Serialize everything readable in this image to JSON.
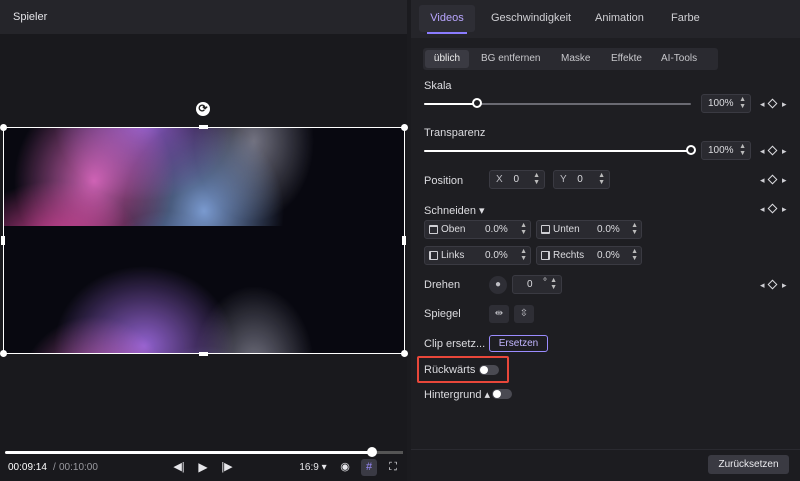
{
  "player": {
    "title": "Spieler",
    "rotate_glyph": "⟳",
    "time_current": "00:09:14",
    "time_separator": "/",
    "time_total": "00:10:00",
    "progress_fraction": 0.923,
    "controls": {
      "prev_frame_glyph": "◀|",
      "play_glyph": "▶",
      "next_frame_glyph": "|▶",
      "aspect_ratio": "16:9 ▾",
      "snapshot_glyph": "◉",
      "grid_glyph": "#",
      "fullscreen_glyph": "⛶"
    }
  },
  "editor": {
    "tabs": {
      "videos": "Videos",
      "speed": "Geschwindigkeit",
      "animation": "Animation",
      "color": "Farbe"
    },
    "subtabs": {
      "ueblich": "üblich",
      "bg_remove": "BG entfernen",
      "mask": "Maske",
      "effects": "Effekte",
      "ai_tools": "AI-Tools"
    },
    "scale": {
      "label": "Skala",
      "value": "100%",
      "fraction": 0.2
    },
    "opacity": {
      "label": "Transparenz",
      "value": "100%",
      "fraction": 1.0
    },
    "position": {
      "label": "Position",
      "x_label": "X",
      "x_value": "0",
      "y_label": "Y",
      "y_value": "0"
    },
    "crop": {
      "label": "Schneiden ▾",
      "top_label": "Oben",
      "top_value": "0.0%",
      "bottom_label": "Unten",
      "bottom_value": "0.0%",
      "left_label": "Links",
      "left_value": "0.0%",
      "right_label": "Rechts",
      "right_value": "0.0%"
    },
    "rotate": {
      "label": "Drehen",
      "value": "0",
      "unit": "°"
    },
    "mirror": {
      "label": "Spiegel"
    },
    "clip_replace": {
      "label": "Clip ersetz...",
      "button": "Ersetzen"
    },
    "reverse": {
      "label": "Rückwärts",
      "enabled": false
    },
    "background": {
      "label": "Hintergrund ▴",
      "enabled": false
    },
    "reset_button": "Zurücksetzen"
  },
  "colors": {
    "accent": "#8b7cff",
    "highlight": "#e8473a"
  }
}
